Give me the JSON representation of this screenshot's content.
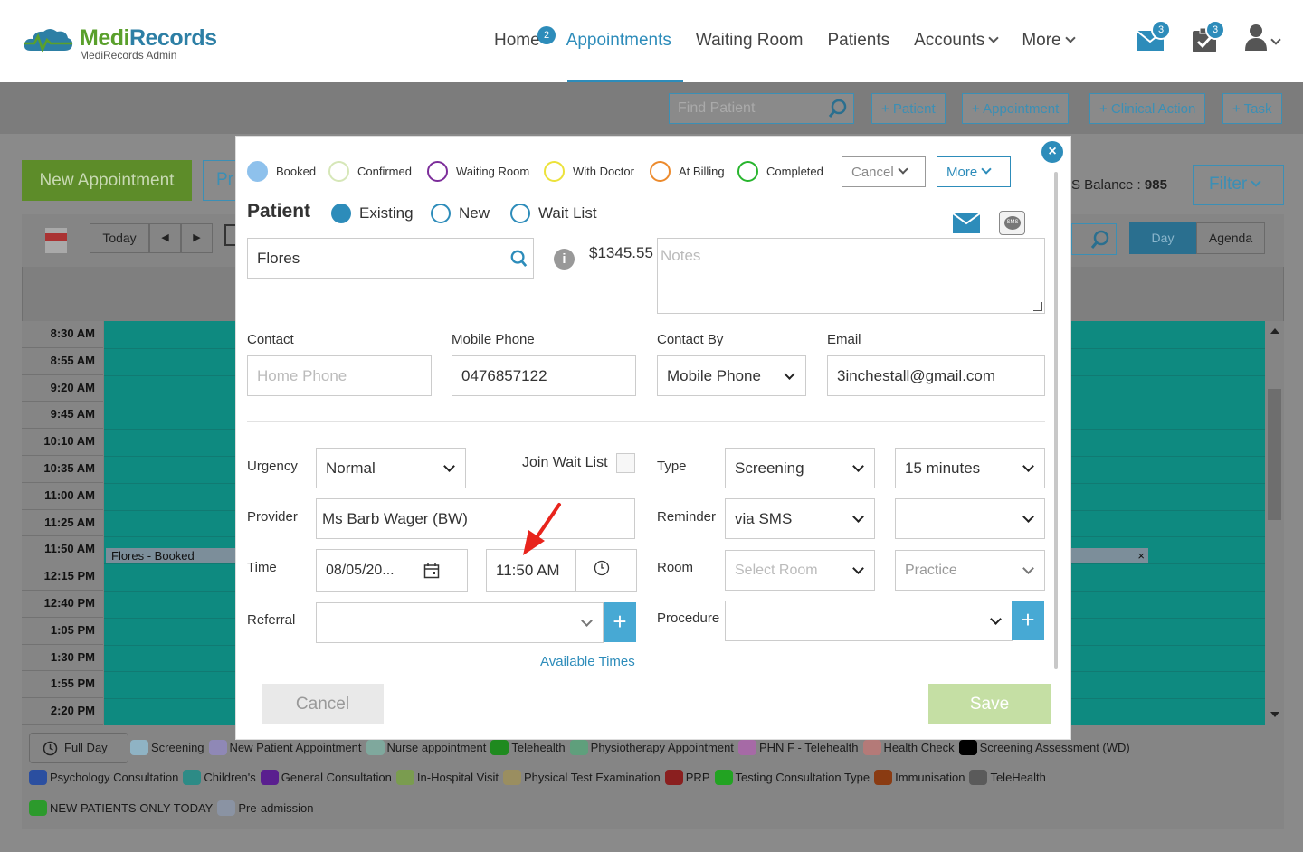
{
  "brand": {
    "name_part1": "Medi",
    "name_part2": "Records",
    "subtitle": "MediRecords Admin"
  },
  "nav": {
    "items": [
      {
        "label": "Home",
        "badge": "2"
      },
      {
        "label": "Appointments"
      },
      {
        "label": "Waiting Room"
      },
      {
        "label": "Patients"
      },
      {
        "label": "Accounts"
      },
      {
        "label": "More"
      }
    ],
    "mail_badge": "3",
    "tasks_badge": "3"
  },
  "toolbar": {
    "find_placeholder": "Find Patient",
    "buttons": [
      "+ Patient",
      "+ Appointment",
      "+ Clinical Action",
      "+ Task"
    ]
  },
  "page": {
    "new_appointment": "New Appointment",
    "pr_button": "Pr",
    "balance_label": "S Balance : ",
    "balance_value": "985",
    "filter": "Filter",
    "today": "Today",
    "prev": "◀",
    "next": "▶",
    "view_day": "Day",
    "view_agenda": "Agenda",
    "times": [
      "8:30 AM",
      "8:55 AM",
      "9:20 AM",
      "9:45 AM",
      "10:10 AM",
      "10:35 AM",
      "11:00 AM",
      "11:25 AM",
      "11:50 AM",
      "12:15 PM",
      "12:40 PM",
      "1:05 PM",
      "1:30 PM",
      "1:55 PM",
      "2:20 PM"
    ],
    "booking_label": "Flores - Booked",
    "full_day": "Full Day",
    "legend_row1": [
      {
        "label": "Screening",
        "color": "#8fb3c4"
      },
      {
        "label": "New Patient Appointment",
        "color": "#8f88b6"
      },
      {
        "label": "Nurse appointment",
        "color": "#7fa89d"
      },
      {
        "label": "Telehealth",
        "color": "#1f8a1f"
      },
      {
        "label": "Physiotherapy Appointment",
        "color": "#5f9f7c"
      },
      {
        "label": "PHN F - Telehealth",
        "color": "#a66aa6"
      },
      {
        "label": "Health Check",
        "color": "#b47a78"
      },
      {
        "label": "Screening Assessment (WD)",
        "color": "#000000"
      }
    ],
    "legend_row2": [
      {
        "label": "Psychology Consultation",
        "color": "#2b4fa0"
      },
      {
        "label": "Children's",
        "color": "#2d8b86"
      },
      {
        "label": "General Consultation",
        "color": "#5a1f8f"
      },
      {
        "label": "In-Hospital Visit",
        "color": "#7a9c4f"
      },
      {
        "label": "Physical Test Examination",
        "color": "#9a8e60"
      },
      {
        "label": "PRP",
        "color": "#8a1f1f"
      },
      {
        "label": "Testing Consultation Type",
        "color": "#22a322"
      },
      {
        "label": "Immunisation",
        "color": "#8a3b12"
      },
      {
        "label": "TeleHealth",
        "color": "#5a5a5a"
      }
    ],
    "legend_row3": [
      {
        "label": "NEW PATIENTS ONLY TODAY",
        "color": "#2c9a2c"
      },
      {
        "label": "Pre-admission",
        "color": "#8a93a3"
      }
    ]
  },
  "modal": {
    "statuses": [
      {
        "label": "Booked",
        "color": "#2d8cba",
        "fill": "#8ec1ec"
      },
      {
        "label": "Confirmed",
        "color": "#d6e7b8",
        "fill": "#ffffff"
      },
      {
        "label": "Waiting Room",
        "color": "#7c2d9a",
        "fill": "#ffffff"
      },
      {
        "label": "With Doctor",
        "color": "#ece23a",
        "fill": "#ffffff"
      },
      {
        "label": "At Billing",
        "color": "#ec8a2c",
        "fill": "#ffffff"
      },
      {
        "label": "Completed",
        "color": "#28b52e",
        "fill": "#ffffff"
      }
    ],
    "cancel_dropdown": "Cancel",
    "more_dropdown": "More",
    "patient_heading": "Patient",
    "patient_types": [
      "Existing",
      "New",
      "Wait List"
    ],
    "patient_search": "Flores",
    "balance": "$1345.55",
    "notes_placeholder": "Notes",
    "contact_label": "Contact",
    "home_phone_placeholder": "Home Phone",
    "mobile_label": "Mobile Phone",
    "mobile_value": "0476857122",
    "contact_by_label": "Contact By",
    "contact_by_value": "Mobile Phone",
    "email_label": "Email",
    "email_value": "3inchestall@gmail.com",
    "urgency_label": "Urgency",
    "urgency_value": "Normal",
    "join_wait_list": "Join Wait List",
    "type_label": "Type",
    "type_value": "Screening",
    "duration_value": "15 minutes",
    "provider_label": "Provider",
    "provider_value": "Ms Barb Wager (BW)",
    "reminder_label": "Reminder",
    "reminder_value": "via SMS",
    "reminder_extra": "",
    "time_label": "Time",
    "date_value": "08/05/20...",
    "time_value": "11:50 AM",
    "room_label": "Room",
    "room_placeholder": "Select Room",
    "practice_placeholder": "Practice",
    "referral_label": "Referral",
    "referral_value": "",
    "procedure_label": "Procedure",
    "procedure_value": "",
    "available_times": "Available Times",
    "cancel": "Cancel",
    "save": "Save",
    "sms_badge": "SMS",
    "colors": {
      "accent": "#2d8cba",
      "save": "#c5dfa4",
      "arrow": "#e8241c"
    }
  }
}
